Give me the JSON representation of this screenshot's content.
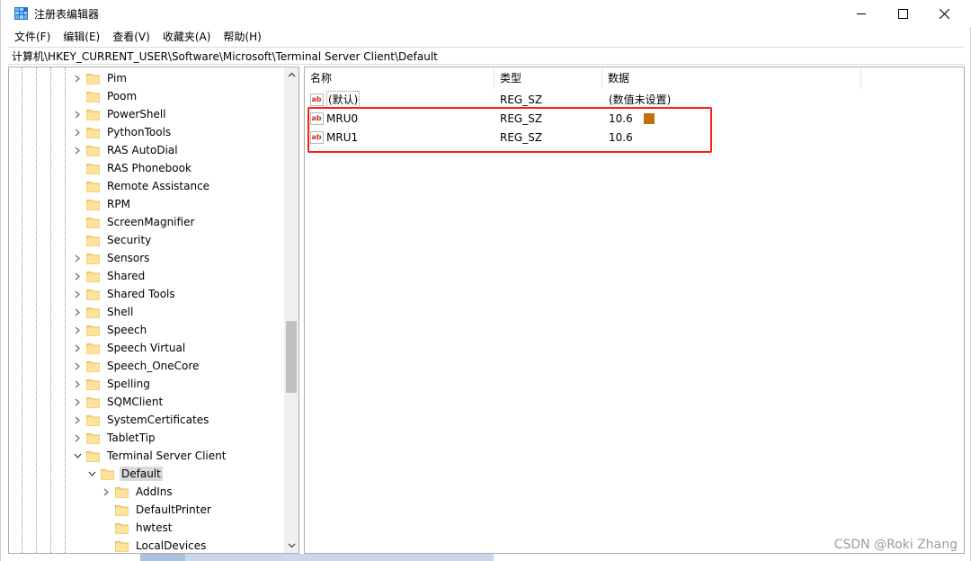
{
  "window": {
    "title": "注册表编辑器",
    "icon": "regedit-icon",
    "controls": [
      "minimize-icon",
      "maximize-icon",
      "close-icon"
    ]
  },
  "menu": [
    "文件(F)",
    "编辑(E)",
    "查看(V)",
    "收藏夹(A)",
    "帮助(H)"
  ],
  "address": "计算机\\HKEY_CURRENT_USER\\Software\\Microsoft\\Terminal Server Client\\Default",
  "tree": {
    "items": [
      {
        "label": "Pim",
        "expander": "collapsed"
      },
      {
        "label": "Poom",
        "expander": "none"
      },
      {
        "label": "PowerShell",
        "expander": "collapsed"
      },
      {
        "label": "PythonTools",
        "expander": "collapsed"
      },
      {
        "label": "RAS AutoDial",
        "expander": "collapsed"
      },
      {
        "label": "RAS Phonebook",
        "expander": "none"
      },
      {
        "label": "Remote Assistance",
        "expander": "none"
      },
      {
        "label": "RPM",
        "expander": "none"
      },
      {
        "label": "ScreenMagnifier",
        "expander": "none"
      },
      {
        "label": "Security",
        "expander": "none"
      },
      {
        "label": "Sensors",
        "expander": "collapsed"
      },
      {
        "label": "Shared",
        "expander": "collapsed"
      },
      {
        "label": "Shared Tools",
        "expander": "collapsed"
      },
      {
        "label": "Shell",
        "expander": "collapsed"
      },
      {
        "label": "Speech",
        "expander": "collapsed"
      },
      {
        "label": "Speech Virtual",
        "expander": "collapsed"
      },
      {
        "label": "Speech_OneCore",
        "expander": "collapsed"
      },
      {
        "label": "Spelling",
        "expander": "collapsed"
      },
      {
        "label": "SQMClient",
        "expander": "collapsed"
      },
      {
        "label": "SystemCertificates",
        "expander": "collapsed"
      },
      {
        "label": "TabletTip",
        "expander": "collapsed"
      },
      {
        "label": "Terminal Server Client",
        "expander": "expanded"
      },
      {
        "label": "Default",
        "expander": "expanded",
        "selected": true
      },
      {
        "label": "AddIns",
        "expander": "collapsed"
      },
      {
        "label": "DefaultPrinter",
        "expander": "none"
      },
      {
        "label": "hwtest",
        "expander": "none"
      },
      {
        "label": "LocalDevices",
        "expander": "none"
      }
    ]
  },
  "list": {
    "columns": [
      "名称",
      "类型",
      "数据"
    ],
    "rows": [
      {
        "name": "(默认)",
        "type": "REG_SZ",
        "data": "(数值未设置)",
        "icon": "reg-sz-icon"
      },
      {
        "name": "MRU0",
        "type": "REG_SZ",
        "data": "10.6",
        "icon": "reg-sz-icon"
      },
      {
        "name": "MRU1",
        "type": "REG_SZ",
        "data": "10.6",
        "icon": "reg-sz-icon"
      }
    ],
    "highlight_color": "#ff1a1a"
  },
  "watermark": "CSDN @Roki Zhang"
}
